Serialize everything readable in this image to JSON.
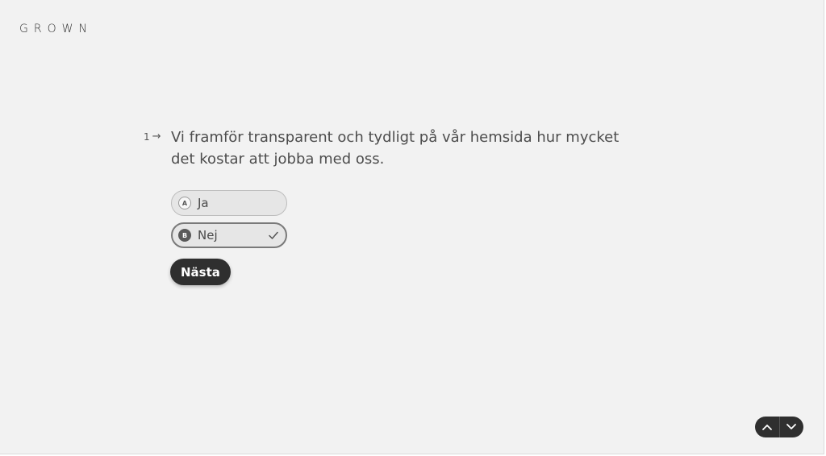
{
  "brand": {
    "logo_text": "GROWN"
  },
  "question": {
    "number": "1",
    "arrow_icon": "arrow-right-icon",
    "text": "Vi framför transparent och tydligt på vår hemsida hur mycket det kostar att jobba med oss."
  },
  "choices": [
    {
      "key": "A",
      "label": "Ja",
      "selected": false
    },
    {
      "key": "B",
      "label": "Nej",
      "selected": true
    }
  ],
  "next_button": {
    "label": "Nästa"
  },
  "navigation": {
    "up_icon": "chevron-up-icon",
    "down_icon": "chevron-down-icon"
  },
  "colors": {
    "background": "#f2f2f2",
    "text": "#4a4a4a",
    "button": "#2f2f2f",
    "selected_border": "#7a7a7a"
  }
}
